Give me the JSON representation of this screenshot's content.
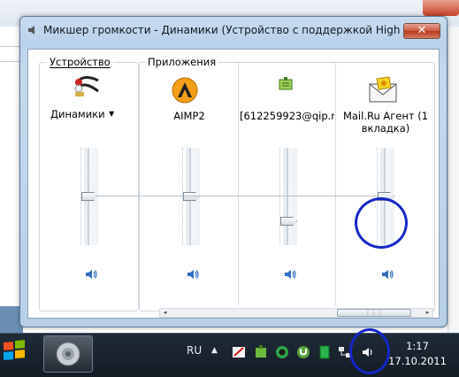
{
  "window": {
    "title": "Микшер громкости - Динамики (Устройство с поддержкой High Definition Audio)",
    "close_glyph": "✕"
  },
  "device": {
    "group_label": "Устройство",
    "name": "Динамики",
    "dropdown_glyph": "▼",
    "level": 0.5
  },
  "apps": {
    "group_label": "Приложения",
    "columns": [
      {
        "name": "AIMP2",
        "level": 0.5
      },
      {
        "name": "[612259923@qip.r...",
        "level": 0.22
      },
      {
        "name": "Mail.Ru Агент (1\nвкладка)",
        "level": 0.5
      }
    ]
  },
  "scrollbar": {
    "left_arrow": "◂",
    "right_arrow": "▸",
    "thumb_grip": "⋮⋮⋮"
  },
  "taskbar": {
    "language": "RU",
    "tray_arrow": "▲",
    "time": "1:17",
    "date": "17.10.2011"
  },
  "colors": {
    "annotation": "#1427c7",
    "window_frame": "#b9d1ea",
    "taskbar": "#1a2530"
  }
}
